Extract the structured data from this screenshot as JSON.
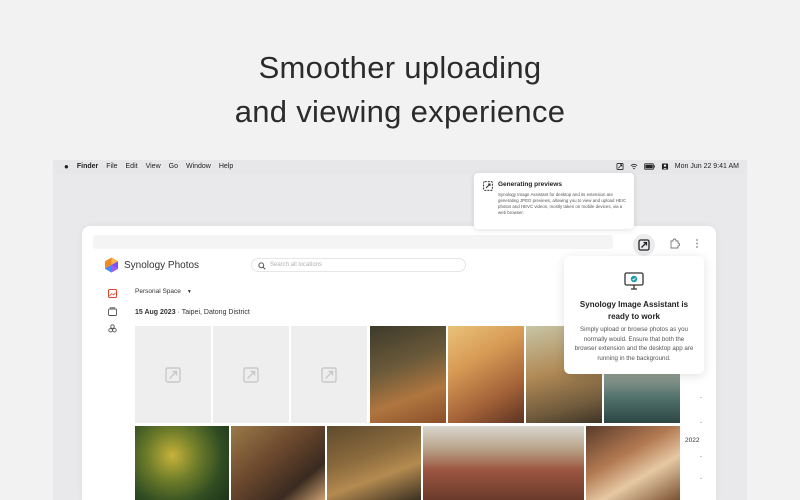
{
  "headline": {
    "line1": "Smoother uploading",
    "line2": "and viewing experience"
  },
  "menubar": {
    "items": [
      "Finder",
      "File",
      "Edit",
      "View",
      "Go",
      "Window",
      "Help"
    ],
    "clock": "Mon Jun 22  9:41 AM",
    "icons": [
      "apple-icon",
      "image-assistant-icon",
      "wifi-icon",
      "battery-icon",
      "user-icon"
    ]
  },
  "popover": {
    "title": "Generating previews",
    "body": "Synology Image Assistant for desktop and its extension are generating JPEG previews, allowing you to view and upload HEIC photos and HEVC videos, mostly taken on mobile devices, via a web browser."
  },
  "app": {
    "name": "Synology Photos",
    "search_placeholder": "Search all locations",
    "space": "Personal Space",
    "date": "15 Aug 2023",
    "location": "Taipei, Datong District",
    "year_marker": "2022",
    "sidebar_icons": [
      "photos-icon",
      "albums-icon",
      "shared-icon"
    ]
  },
  "assistant_card": {
    "title": "Synology Image Assistant is ready to work",
    "body": "Simply upload or browse photos as you normally would. Ensure that both the browser extension and the desktop app are running in the background."
  },
  "colors": {
    "logo_orange": "#f08a24",
    "logo_purple": "#7c4dff",
    "logo_blue": "#3c8cff",
    "check_teal": "#1e9aa8"
  }
}
